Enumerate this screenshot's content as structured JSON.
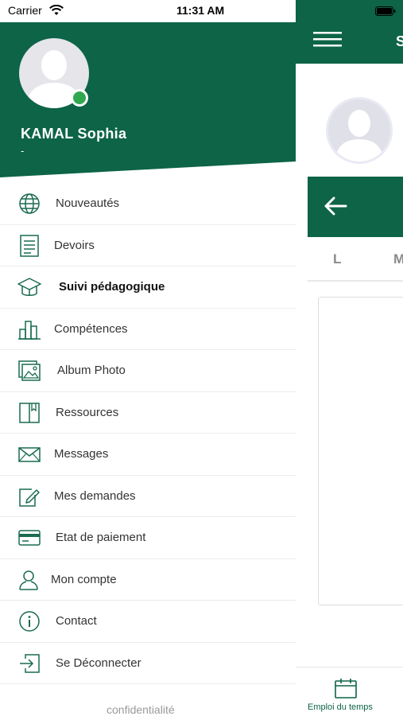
{
  "status_bar": {
    "carrier": "Carrier",
    "time": "11:31 AM"
  },
  "colors": {
    "brand": "#0d6447",
    "online": "#2fa84f",
    "icon": "#1a6b50"
  },
  "drawer": {
    "user": {
      "name": "KAMAL Sophia",
      "subtitle": "-"
    },
    "items": [
      {
        "label": "Nouveautés",
        "icon": "globe-icon"
      },
      {
        "label": "Devoirs",
        "icon": "document-icon"
      },
      {
        "label": "Suivi pédagogique",
        "icon": "graduation-cap-icon",
        "active": true
      },
      {
        "label": "Compétences",
        "icon": "bar-chart-icon"
      },
      {
        "label": "Album Photo",
        "icon": "photo-album-icon"
      },
      {
        "label": "Ressources",
        "icon": "book-icon"
      },
      {
        "label": "Messages",
        "icon": "mail-icon"
      },
      {
        "label": "Mes demandes",
        "icon": "edit-icon"
      },
      {
        "label": "Etat de paiement",
        "icon": "credit-card-icon"
      },
      {
        "label": "Mon compte",
        "icon": "user-icon"
      },
      {
        "label": "Contact",
        "icon": "info-icon"
      },
      {
        "label": "Se Déconnecter",
        "icon": "logout-icon"
      }
    ],
    "footer": "confidentialité"
  },
  "background_screen": {
    "title": "S",
    "days": [
      "L",
      "M"
    ],
    "tab": {
      "label": "Emploi du temps",
      "icon": "calendar-icon"
    }
  }
}
